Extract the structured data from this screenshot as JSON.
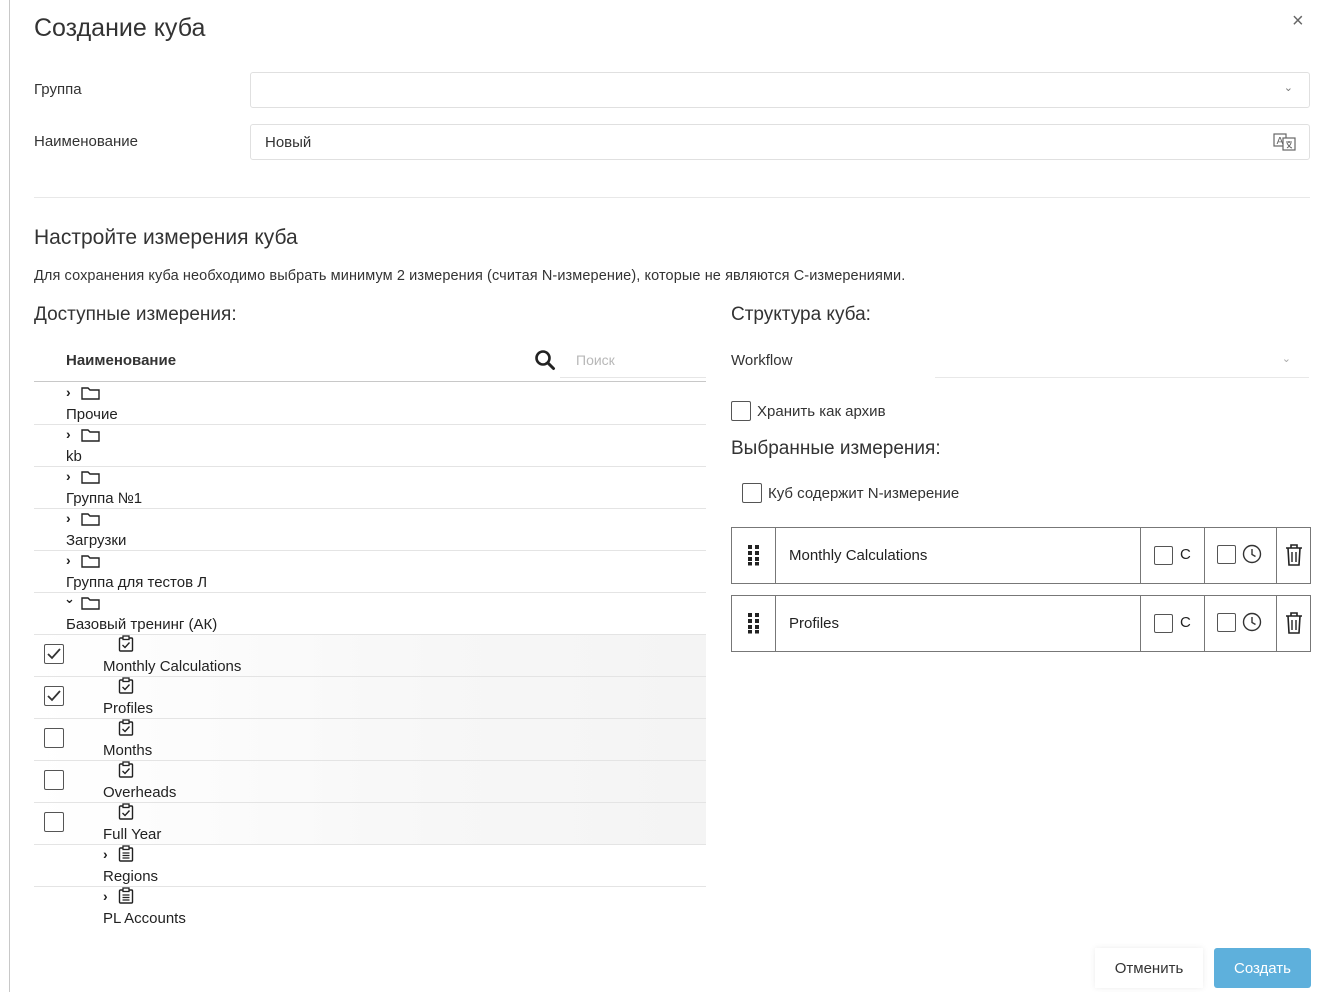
{
  "dialog": {
    "title": "Создание куба",
    "close_icon": "close-icon",
    "close_glyph": "×"
  },
  "form": {
    "group_label": "Группа",
    "group_value": "",
    "name_label": "Наименование",
    "name_value": "Новый",
    "translate_icon": "translate-icon"
  },
  "dimensions_section": {
    "title": "Настройте измерения куба",
    "hint": "Для сохранения куба необходимо выбрать минимум 2 измерения (считая N-измерение), которые не являются С-измерениями."
  },
  "available": {
    "title": "Доступные измерения:",
    "column_header": "Наименование",
    "search_placeholder": "Поиск",
    "search_icon": "search-icon",
    "folders": [
      {
        "label": "Прочие",
        "expanded": false,
        "icon": "folder-icon"
      },
      {
        "label": "kb",
        "expanded": false,
        "icon": "folder-icon"
      },
      {
        "label": "Группа №1",
        "expanded": false,
        "icon": "folder-icon"
      },
      {
        "label": "Загрузки",
        "expanded": false,
        "icon": "folder-icon"
      },
      {
        "label": "Группа для тестов Л",
        "expanded": false,
        "icon": "folder-icon"
      },
      {
        "label": "Базовый тренинг (АК)",
        "expanded": true,
        "icon": "folder-icon"
      }
    ],
    "items": [
      {
        "label": "Monthly Calculations",
        "checked": true,
        "icon": "clipboard-check-icon"
      },
      {
        "label": "Profiles",
        "checked": true,
        "icon": "clipboard-check-icon"
      },
      {
        "label": "Months",
        "checked": false,
        "icon": "clipboard-check-icon"
      },
      {
        "label": "Overheads",
        "checked": false,
        "icon": "clipboard-check-icon"
      },
      {
        "label": "Full Year",
        "checked": false,
        "icon": "clipboard-check-icon"
      },
      {
        "label": "Regions",
        "expandable": true,
        "icon": "clipboard-list-icon"
      },
      {
        "label": "PL Accounts",
        "expandable": true,
        "icon": "clipboard-list-icon"
      }
    ]
  },
  "structure": {
    "title": "Структура куба:",
    "workflow_label": "Workflow",
    "workflow_value": "",
    "archive_label": "Хранить как архив",
    "archive_checked": false,
    "selected_title": "Выбранные измерения:",
    "n_dim_label": "Куб содержит N-измерение",
    "n_dim_checked": false,
    "selected": [
      {
        "label": "Monthly Calculations",
        "c_label": "С",
        "c_checked": false,
        "time_checked": false
      },
      {
        "label": "Profiles",
        "c_label": "С",
        "c_checked": false,
        "time_checked": false
      }
    ]
  },
  "footer": {
    "cancel_label": "Отменить",
    "create_label": "Создать",
    "create_color": "#5eb0dc"
  }
}
